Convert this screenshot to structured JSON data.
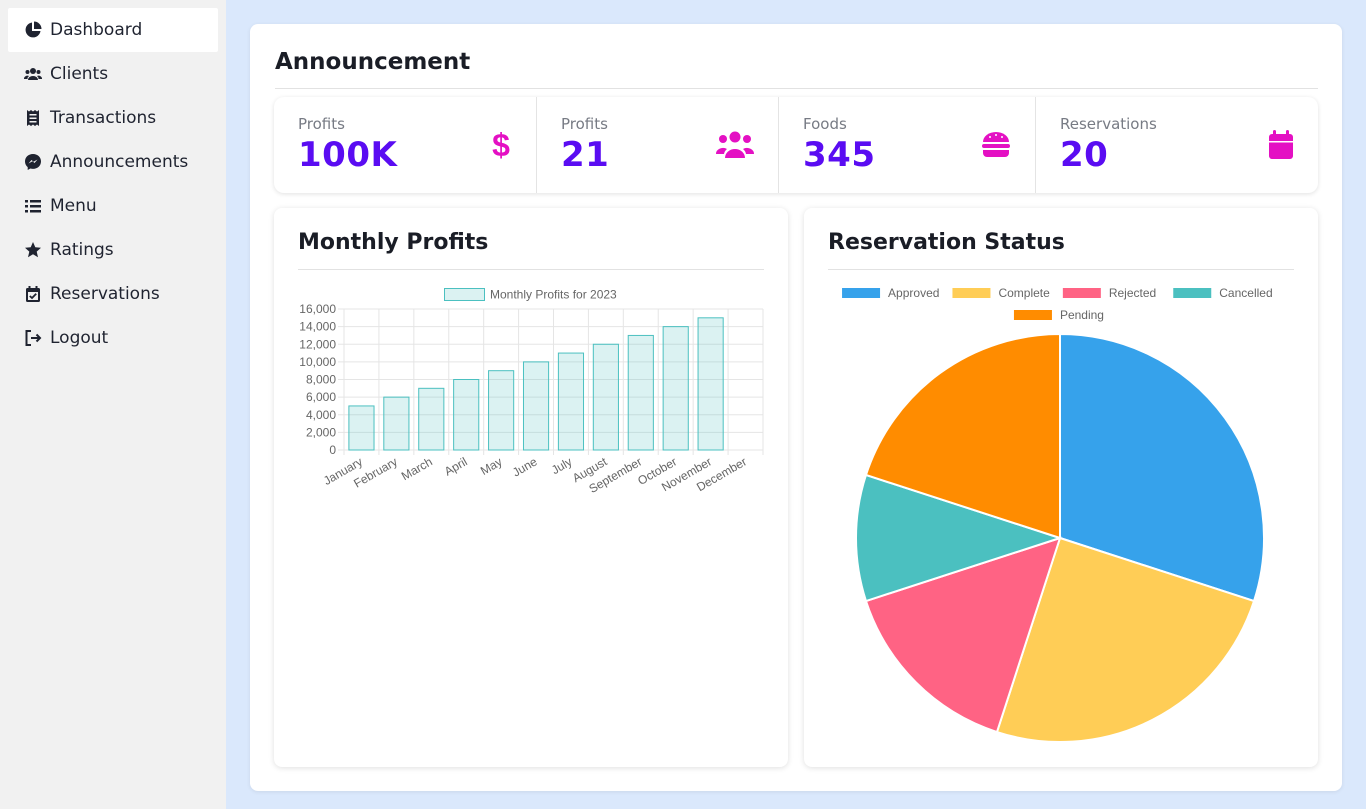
{
  "sidebar": {
    "items": [
      {
        "label": "Dashboard",
        "icon": "pie-chart-icon",
        "active": true
      },
      {
        "label": "Clients",
        "icon": "users-icon",
        "active": false
      },
      {
        "label": "Transactions",
        "icon": "receipt-icon",
        "active": false
      },
      {
        "label": "Announcements",
        "icon": "messenger-icon",
        "active": false
      },
      {
        "label": "Menu",
        "icon": "list-icon",
        "active": false
      },
      {
        "label": "Ratings",
        "icon": "star-icon",
        "active": false
      },
      {
        "label": "Reservations",
        "icon": "calendar-check-icon",
        "active": false
      },
      {
        "label": "Logout",
        "icon": "logout-icon",
        "active": false
      }
    ]
  },
  "page": {
    "title": "Announcement"
  },
  "stats": [
    {
      "label": "Profits",
      "value": "100K",
      "icon": "dollar-icon"
    },
    {
      "label": "Profits",
      "value": "21",
      "icon": "users-icon"
    },
    {
      "label": "Foods",
      "value": "345",
      "icon": "burger-icon"
    },
    {
      "label": "Reservations",
      "value": "20",
      "icon": "calendar-icon"
    }
  ],
  "colors": {
    "accent": "#5a0cf2",
    "icon": "#e410c3",
    "background": "#dae8fc",
    "sidebar": "#f1f1f1"
  },
  "panels": {
    "profits_title": "Monthly Profits",
    "status_title": "Reservation Status"
  },
  "chart_data": [
    {
      "type": "bar",
      "title": "",
      "categories": [
        "January",
        "February",
        "March",
        "April",
        "May",
        "June",
        "July",
        "August",
        "September",
        "October",
        "November",
        "December"
      ],
      "series": [
        {
          "name": "Monthly Profits for 2023",
          "values": [
            5000,
            6000,
            7000,
            8000,
            9000,
            10000,
            11000,
            12000,
            13000,
            14000,
            15000,
            null
          ],
          "color": "#4bc0c0"
        }
      ],
      "ylim": [
        0,
        16000
      ],
      "yticks": [
        "16,000",
        "14,000",
        "12,000",
        "10,000",
        "8,000",
        "6,000",
        "4,000",
        "2,000",
        "0"
      ],
      "legend": "top",
      "grid": true
    },
    {
      "type": "pie",
      "title": "",
      "legend": "top",
      "slices": [
        {
          "label": "Approved",
          "value": 30,
          "color": "#36a2eb"
        },
        {
          "label": "Complete",
          "value": 25,
          "color": "#ffcd56"
        },
        {
          "label": "Rejected",
          "value": 15,
          "color": "#ff6384"
        },
        {
          "label": "Cancelled",
          "value": 10,
          "color": "#4bc0c0"
        },
        {
          "label": "Pending",
          "value": 20,
          "color": "#ff8c00"
        }
      ]
    }
  ]
}
